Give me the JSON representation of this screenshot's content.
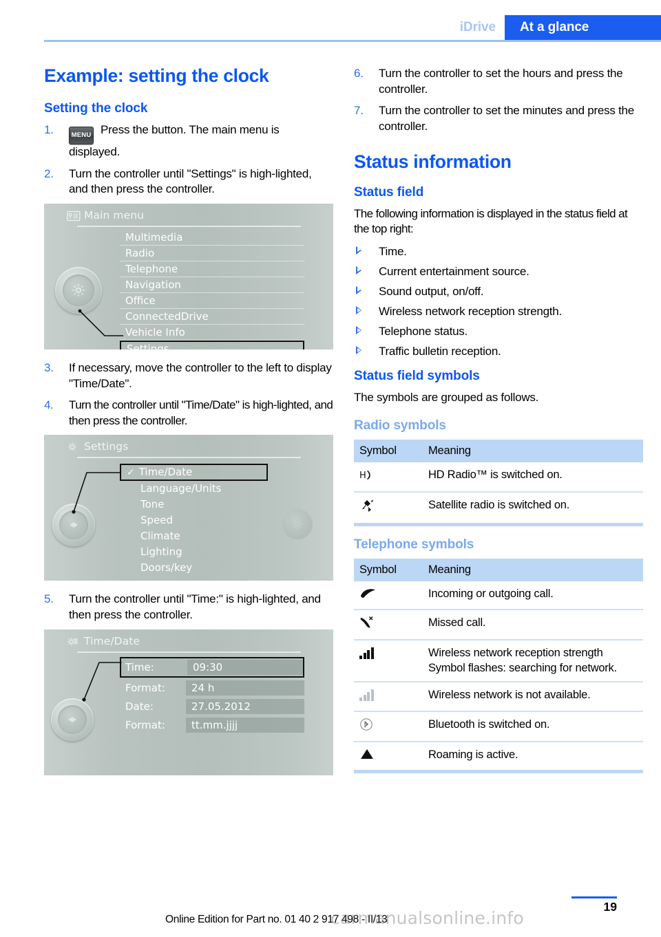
{
  "header": {
    "tab_inactive": "iDrive",
    "tab_active": "At a glance",
    "accent_blue": "#1a5df0",
    "muted_blue": "#a9c5f5"
  },
  "left_column": {
    "h1": "Example: setting the clock",
    "h2": "Setting the clock",
    "steps": [
      {
        "num": "1.",
        "icon_label": "MENU",
        "text": "Press the button. The main menu is displayed."
      },
      {
        "num": "2.",
        "text": "Turn the controller until \"Settings\" is high-lighted, and then press the controller."
      },
      {
        "num": "3.",
        "text": "If necessary, move the controller to the left to display \"Time/Date\"."
      },
      {
        "num": "4.",
        "text": "Turn the controller until \"Time/Date\" is high-lighted, and then press the controller."
      },
      {
        "num": "5.",
        "text": "Turn the controller until \"Time:\" is high-lighted, and then press the controller."
      }
    ],
    "screen_main_menu": {
      "title": "Main menu",
      "title_icon": "list-card-icon",
      "knob_icon": "gear-icon",
      "items": [
        {
          "label": "Multimedia",
          "selected": false
        },
        {
          "label": "Radio",
          "selected": false
        },
        {
          "label": "Telephone",
          "selected": false
        },
        {
          "label": "Navigation",
          "selected": false
        },
        {
          "label": "Office",
          "selected": false
        },
        {
          "label": "ConnectedDrive",
          "selected": false
        },
        {
          "label": "Vehicle Info",
          "selected": false
        },
        {
          "label": "Settings",
          "selected": true
        }
      ]
    },
    "screen_settings": {
      "title": "Settings",
      "title_icon": "gear-icon",
      "knob_icon": "left-right-arrows-icon",
      "items": [
        {
          "label": "Time/Date",
          "selected": true,
          "check": "✓"
        },
        {
          "label": "Language/Units",
          "selected": false
        },
        {
          "label": "Tone",
          "selected": false
        },
        {
          "label": "Speed",
          "selected": false
        },
        {
          "label": "Climate",
          "selected": false
        },
        {
          "label": "Lighting",
          "selected": false
        },
        {
          "label": "Doors/key",
          "selected": false
        }
      ]
    },
    "screen_time_date": {
      "title": "Time/Date",
      "title_icon": "gears-icon",
      "knob_icon": "left-right-arrows-icon",
      "rows": [
        {
          "key": "Time:",
          "value": "09:30",
          "selected": true
        },
        {
          "key": "Format:",
          "value": "24 h",
          "selected": false
        },
        {
          "key": "Date:",
          "value": "27.05.2012",
          "selected": false
        },
        {
          "key": "Format:",
          "value": "tt.mm.jjjj",
          "selected": false
        }
      ]
    }
  },
  "right_column": {
    "steps": [
      {
        "num": "6.",
        "text": "Turn the controller to set the hours and press the controller."
      },
      {
        "num": "7.",
        "text": "Turn the controller to set the minutes and press the controller."
      }
    ],
    "h1": "Status information",
    "status_field": {
      "heading": "Status field",
      "intro": "The following information is displayed in the status field at the top right:",
      "bullets": [
        "Time.",
        "Current entertainment source.",
        "Sound output, on/off.",
        "Wireless network reception strength.",
        "Telephone status.",
        "Traffic bulletin reception."
      ]
    },
    "status_field_symbols": {
      "heading": "Status field symbols",
      "intro": "The symbols are grouped as follows."
    },
    "radio_symbols": {
      "heading": "Radio symbols",
      "columns": [
        "Symbol",
        "Meaning"
      ],
      "rows": [
        {
          "symbol": "hd-radio-icon",
          "meaning": "HD Radio™ is switched on."
        },
        {
          "symbol": "satellite-radio-icon",
          "meaning": "Satellite radio is switched on."
        }
      ]
    },
    "telephone_symbols": {
      "heading": "Telephone symbols",
      "columns": [
        "Symbol",
        "Meaning"
      ],
      "rows": [
        {
          "symbol": "handset-icon",
          "meaning": "Incoming or outgoing call."
        },
        {
          "symbol": "missed-call-icon",
          "meaning": "Missed call."
        },
        {
          "symbol": "signal-bars-icon",
          "meaning": "Wireless network reception strength Symbol flashes: searching for network."
        },
        {
          "symbol": "signal-bars-gray-icon",
          "meaning": "Wireless network is not available."
        },
        {
          "symbol": "bluetooth-icon",
          "meaning": "Bluetooth is switched on."
        },
        {
          "symbol": "roaming-triangle-icon",
          "meaning": "Roaming is active."
        }
      ]
    }
  },
  "footer": {
    "online_edition": "Online Edition for Part no. 01 40 2 917 498 - II/13",
    "page_number": "19",
    "watermark": "carmanualsonline.info"
  }
}
